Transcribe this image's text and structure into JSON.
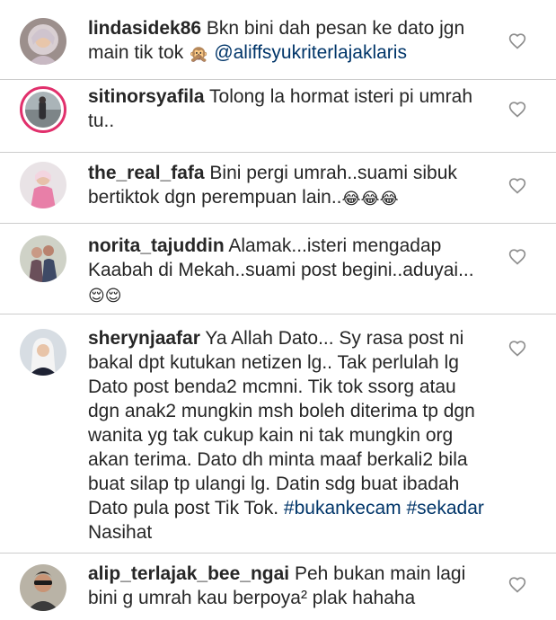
{
  "comments": [
    {
      "username": "lindasidek86",
      "text": "Bkn bini dah pesan ke dato jgn main tik tok",
      "emoji": "🙊",
      "mention": "@aliffsyukriterlajaklaris",
      "avatar": "avatar-hijab-woman"
    },
    {
      "username": "sitinorsyafila",
      "text": "Tolong la hormat isteri pi umrah tu..",
      "avatar": "avatar-beach-photo"
    },
    {
      "username": "the_real_fafa",
      "text": "Bini pergi umrah..suami sibuk bertiktok dgn perempuan lain..",
      "emoji": "😂😂😂",
      "avatar": "avatar-pink-outfit"
    },
    {
      "username": "norita_tajuddin",
      "text": "Alamak...isteri mengadap Kaabah di Mekah..suami post begini..aduyai...",
      "emoji": "😌😌",
      "avatar": "avatar-couple"
    },
    {
      "username": "sherynjaafar",
      "text": "Ya Allah Dato... Sy rasa post ni bakal dpt kutukan netizen lg.. Tak perlulah lg Dato post benda2 mcmni. Tik tok ssorg atau dgn anak2 mungkin msh boleh diterima tp dgn wanita yg tak cukup kain ni tak mungkin org akan terima. Dato dh minta maaf berkali2 bila buat silap tp ulangi lg. Datin sdg buat ibadah Dato pula post Tik Tok.",
      "hashtags": [
        "#bukankecam",
        "#sekadar"
      ],
      "text_end": "Nasihat",
      "avatar": "avatar-hijab-portrait"
    },
    {
      "username": "alip_terlajak_bee_ngai",
      "text": "Peh bukan main lagi bini g umrah kau berpoya² plak hahaha",
      "avatar": "avatar-man-sunglasses"
    }
  ],
  "icons": {
    "like": "heart-outline-icon"
  },
  "colors": {
    "text": "#262626",
    "link": "#003569",
    "heart": "#8e8e8e",
    "story_ring": "#e1306c",
    "divider": "#cccccc"
  }
}
